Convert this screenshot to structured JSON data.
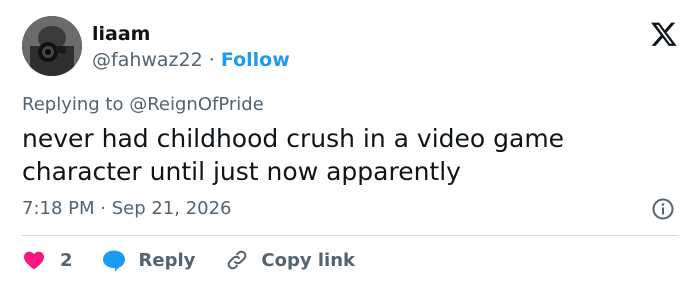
{
  "author": {
    "display_name": "liaam",
    "handle": "@fahwaz22",
    "separator": "·",
    "follow_label": "Follow"
  },
  "brand": {
    "logo_icon": "x-logo-icon"
  },
  "reply_context": {
    "prefix": "Replying to",
    "mention": "@ReignOfPride"
  },
  "tweet": {
    "text": "never had childhood crush in a video game character until just now apparently",
    "timestamp": "7:18 PM · Sep 21, 2026"
  },
  "actions": {
    "like_count": "2",
    "reply_label": "Reply",
    "copy_link_label": "Copy link"
  },
  "colors": {
    "text": "#0f1419",
    "muted": "#536471",
    "accent": "#1d9bf0",
    "like": "#f91880",
    "divider": "#cfd9de"
  }
}
